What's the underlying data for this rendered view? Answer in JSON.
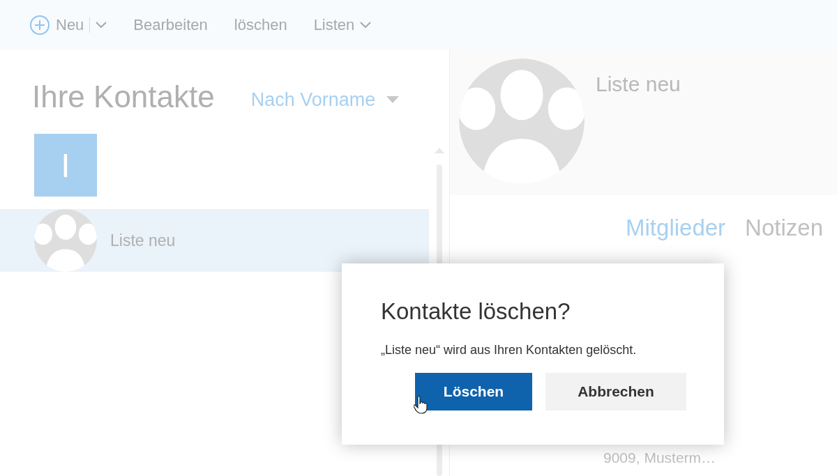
{
  "toolbar": {
    "items": [
      {
        "kind": "new",
        "label": "Neu"
      },
      {
        "kind": "plain",
        "label": "Bearbeiten"
      },
      {
        "kind": "plain",
        "label": "löschen"
      },
      {
        "kind": "dropdown",
        "label": "Listen"
      }
    ]
  },
  "contacts": {
    "title": "Ihre Kontakte",
    "sort": "Nach Vorname",
    "groups": [
      {
        "letter": "I",
        "items": [
          {
            "name": "Liste neu",
            "selected": true
          }
        ]
      }
    ]
  },
  "detail": {
    "name": "Liste neu",
    "tabs": [
      {
        "label": "Mitglieder",
        "selected": true
      },
      {
        "label": "Notizen",
        "selected": false
      }
    ],
    "address": "9009, Musterm…"
  },
  "dialog": {
    "title": "Kontakte löschen?",
    "message": "„Liste neu“ wird aus Ihren Kontakten gelöscht.",
    "buttons": [
      {
        "label": "Löschen",
        "kind": "primary"
      },
      {
        "label": "Abbrechen",
        "kind": "secondary"
      }
    ]
  }
}
